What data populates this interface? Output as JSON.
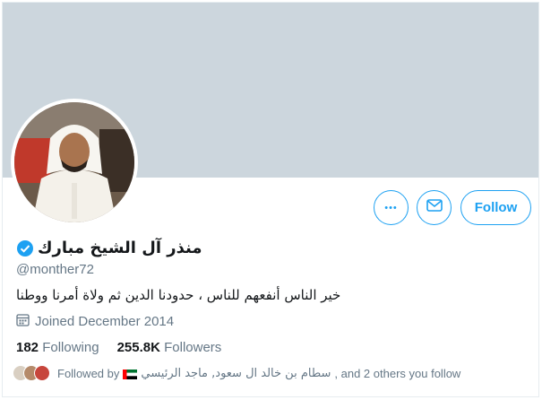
{
  "profile": {
    "display_name": "منذر آل الشيخ مبارك",
    "handle": "@monther72",
    "bio": "خير الناس أنفعهم للناس ، حدودنا الدين ثم ولاة أمرنا ووطنا",
    "joined": "Joined December 2014",
    "verified": true
  },
  "actions": {
    "more_label": "•••",
    "follow_label": "Follow"
  },
  "stats": {
    "following_count": "182",
    "following_label": "Following",
    "followers_count": "255.8K",
    "followers_label": "Followers"
  },
  "followed_by": {
    "prefix": "Followed by",
    "names": "سطام بن خالد ال سعود, ماجد الرئيسي",
    "suffix": ", and 2 others you follow"
  },
  "colors": {
    "accent": "#1da1f2",
    "banner": "#ccd6dd",
    "secondary_text": "#657786"
  },
  "icons": [
    "more-icon",
    "mail-icon",
    "verified-badge-icon",
    "calendar-icon",
    "uae-flag-icon"
  ]
}
